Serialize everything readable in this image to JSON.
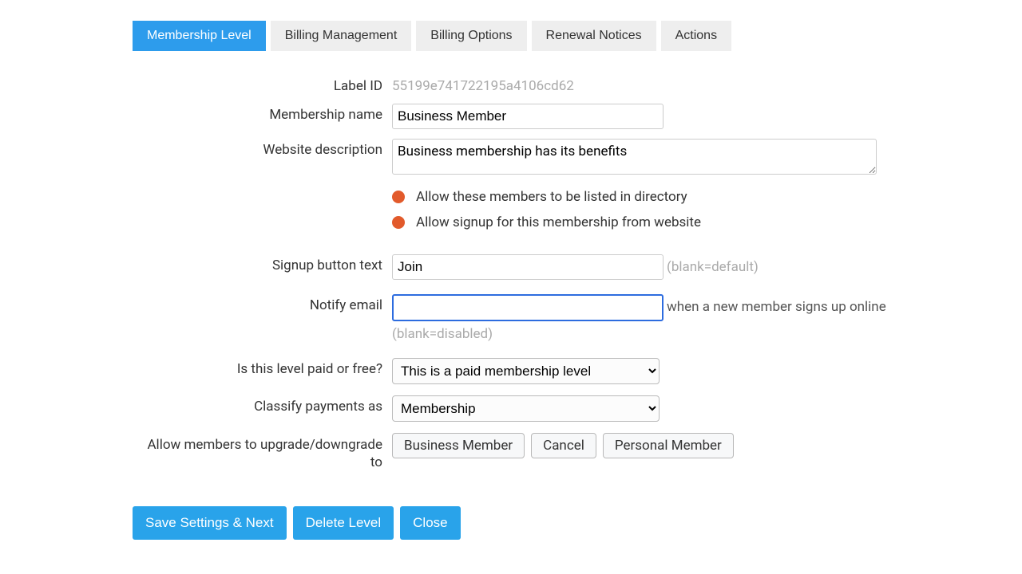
{
  "tabs": [
    {
      "label": "Membership Level"
    },
    {
      "label": "Billing Management"
    },
    {
      "label": "Billing Options"
    },
    {
      "label": "Renewal Notices"
    },
    {
      "label": "Actions"
    }
  ],
  "labels": {
    "label_id": "Label ID",
    "membership_name": "Membership name",
    "website_description": "Website description",
    "signup_button_text": "Signup button text",
    "notify_email": "Notify email",
    "paid_or_free": "Is this level paid or free?",
    "classify": "Classify payments as",
    "upgrade": "Allow members to upgrade/downgrade to"
  },
  "values": {
    "label_id": "55199e741722195a4106cd62",
    "membership_name": "Business Member",
    "website_description": "Business membership has its benefits",
    "signup_button_text": "Join",
    "notify_email": "",
    "paid_option": "This is a paid membership level",
    "classify_option": "Membership"
  },
  "toggles": {
    "allow_directory": "Allow these members to be listed in directory",
    "allow_signup": "Allow signup for this membership from website"
  },
  "hints": {
    "signup_default": "(blank=default)",
    "notify_after": "when a new member signs up online",
    "notify_disabled": "(blank=disabled)"
  },
  "upgrade_tags": [
    "Business Member",
    "Cancel",
    "Personal Member"
  ],
  "buttons": {
    "save_next": "Save Settings & Next",
    "delete": "Delete Level",
    "close": "Close"
  }
}
